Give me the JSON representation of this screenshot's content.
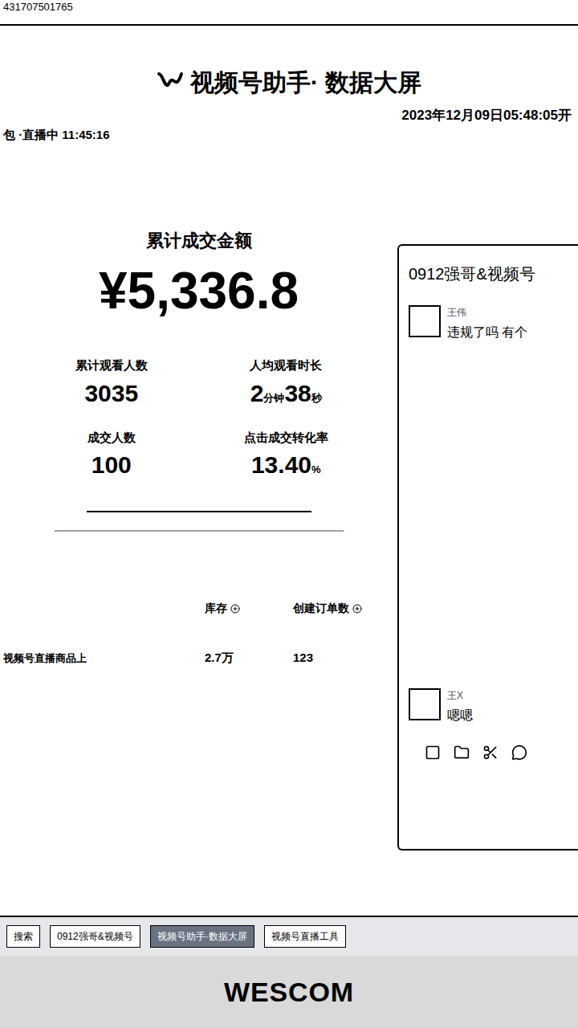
{
  "serial": "431707501765",
  "header": {
    "title": "视频号助手· 数据大屏",
    "datetime": "2023年12月09日05:48:05开",
    "live_label": "包 ·直播中 11:45:16"
  },
  "total_sales": {
    "label": "累计成交金额",
    "value": "¥5,336.8"
  },
  "metrics": [
    {
      "label": "累计观看人数",
      "value": [
        {
          "text": "3035",
          "small": false
        }
      ]
    },
    {
      "label": "人均观看时长",
      "value": [
        {
          "text": "2",
          "small": false
        },
        {
          "text": "分钟",
          "small": true
        },
        {
          "text": "38",
          "small": false
        },
        {
          "text": "秒",
          "small": true
        }
      ]
    },
    {
      "label": "成交人数",
      "value": [
        {
          "text": "100",
          "small": false
        }
      ]
    },
    {
      "label": "点击成交转化率",
      "value": [
        {
          "text": "13.40",
          "small": false
        },
        {
          "text": "%",
          "small": true
        }
      ]
    }
  ],
  "table": {
    "columns": [
      "库存",
      "创建订单数"
    ],
    "rows": [
      {
        "name": "视频号直播商品上",
        "stock": "2.7万",
        "orders": "123"
      }
    ]
  },
  "chat": {
    "title": "0912强哥&视频号",
    "messages": [
      {
        "sender": "王伟",
        "text": "违规了吗 有个"
      },
      {
        "sender": "王X",
        "text": "嗯嗯"
      }
    ]
  },
  "taskbar": {
    "items": [
      {
        "label": "搜索",
        "selected": false
      },
      {
        "label": "0912强哥&视频号",
        "selected": false
      },
      {
        "label": "视频号助手·数据大屏",
        "selected": true
      },
      {
        "label": "视频号直播工具",
        "selected": false
      }
    ]
  },
  "monitor_brand": "WESCOM"
}
